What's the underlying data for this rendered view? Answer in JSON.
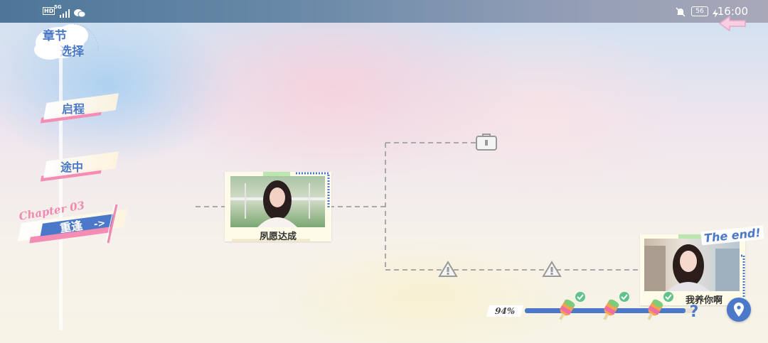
{
  "status_bar": {
    "network_left": "HD",
    "signal": "5G",
    "battery": "56",
    "time": "16:00"
  },
  "header": {
    "title_line1": "章节",
    "title_line2": "选择"
  },
  "chapters": [
    {
      "label": "启程"
    },
    {
      "label": "途中"
    },
    {
      "label": "重逢",
      "chapter_prefix": "Chapter 03",
      "arrow": "->",
      "selected": true
    }
  ],
  "nodes": {
    "main": {
      "title": "夙愿达成"
    },
    "ending": {
      "title": "我养你啊",
      "badge": "The end!"
    }
  },
  "progress": {
    "label": "94%",
    "value": 0.94
  },
  "colors": {
    "accent_blue": "#4b78c9",
    "accent_pink": "#f48cb3",
    "check_green": "#62c28b"
  }
}
